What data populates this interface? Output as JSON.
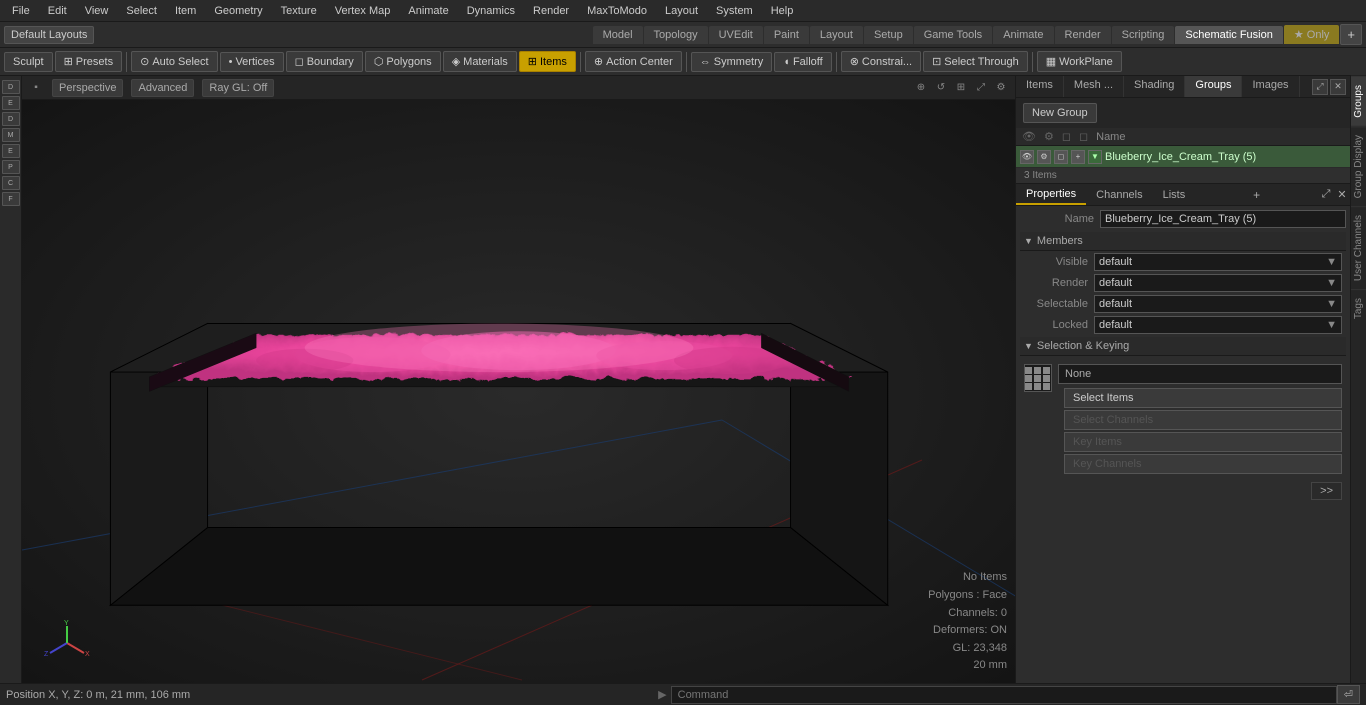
{
  "menubar": {
    "items": [
      "File",
      "Edit",
      "View",
      "Select",
      "Item",
      "Geometry",
      "Texture",
      "Vertex Map",
      "Animate",
      "Dynamics",
      "Render",
      "MaxToModo",
      "Layout",
      "System",
      "Help"
    ]
  },
  "layoutbar": {
    "dropdown": "Default Layouts",
    "tabs": [
      "Model",
      "Topology",
      "UVEdit",
      "Paint",
      "Layout",
      "Setup",
      "Game Tools",
      "Animate",
      "Render",
      "Scripting",
      "Schematic Fusion"
    ],
    "active_tab": "Schematic Fusion",
    "special_tab": "★ Only",
    "add_btn": "+"
  },
  "toolsbar": {
    "sculpt_label": "Sculpt",
    "presets_label": "Presets",
    "tools": [
      {
        "label": "Auto Select",
        "icon": "⊙",
        "active": false
      },
      {
        "label": "Vertices",
        "icon": "•",
        "active": false
      },
      {
        "label": "Boundary",
        "icon": "◻",
        "active": false
      },
      {
        "label": "Polygons",
        "icon": "⬡",
        "active": false
      },
      {
        "label": "Materials",
        "icon": "◈",
        "active": false
      },
      {
        "label": "Items",
        "icon": "⊞",
        "active": true
      },
      {
        "label": "Action Center",
        "icon": "⊕",
        "active": false
      },
      {
        "label": "Symmetry",
        "icon": "⇔",
        "active": false
      },
      {
        "label": "Falloff",
        "icon": "◖",
        "active": false
      },
      {
        "label": "Constrai...",
        "icon": "⊗",
        "active": false
      },
      {
        "label": "Select Through",
        "icon": "⊡",
        "active": false
      },
      {
        "label": "WorkPlane",
        "icon": "▦",
        "active": false
      }
    ]
  },
  "viewport": {
    "mode": "Perspective",
    "shading": "Advanced",
    "raygl": "Ray GL: Off",
    "status": {
      "no_items": "No Items",
      "polygons": "Polygons : Face",
      "channels": "Channels: 0",
      "deformers": "Deformers: ON",
      "gl": "GL: 23,348",
      "size": "20 mm"
    },
    "position": "Position X, Y, Z:  0 m, 21 mm, 106 mm"
  },
  "panel": {
    "tabs": [
      "Items",
      "Mesh ...",
      "Shading",
      "Groups",
      "Images"
    ],
    "active_tab": "Groups",
    "new_group_btn": "New Group",
    "list_header": "Name",
    "group_name": "Blueberry_Ice_Cream_Tray (5)",
    "group_items": "3 Items"
  },
  "properties": {
    "tabs": [
      "Properties",
      "Channels",
      "Lists"
    ],
    "active_tab": "Properties",
    "add_btn": "+",
    "name_label": "Name",
    "name_value": "Blueberry_Ice_Cream_Tray (5)",
    "members_label": "Members",
    "visible_label": "Visible",
    "visible_value": "default",
    "render_label": "Render",
    "render_value": "default",
    "selectable_label": "Selectable",
    "selectable_value": "default",
    "locked_label": "Locked",
    "locked_value": "default",
    "section_keying": "Selection & Keying",
    "keying_value": "None",
    "btn_select_items": "Select Items",
    "btn_select_channels": "Select Channels",
    "btn_key_items": "Key Items",
    "btn_key_channels": "Key Channels"
  },
  "side_tabs": [
    "Groups",
    "Group Display",
    "User Channels",
    "Tags"
  ],
  "bottombar": {
    "position": "Position X, Y, Z:  0 m, 21 mm, 106 mm",
    "arrow": "▶",
    "command_placeholder": "Command"
  }
}
